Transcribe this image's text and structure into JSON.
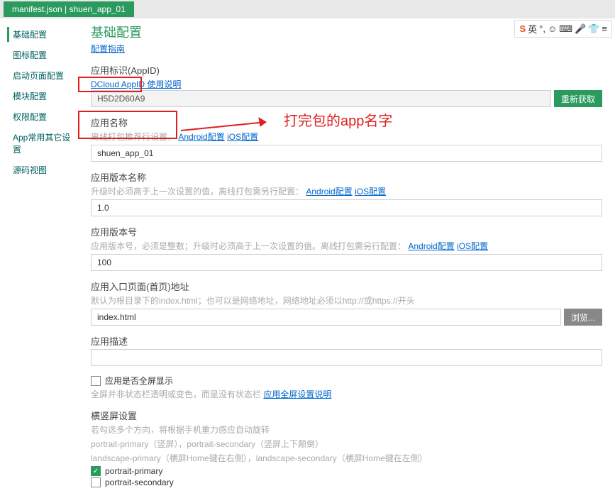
{
  "tab": {
    "title": "manifest.json | shuen_app_01"
  },
  "sidebar": {
    "items": [
      {
        "label": "基础配置"
      },
      {
        "label": "图标配置"
      },
      {
        "label": "启动页面配置"
      },
      {
        "label": "模块配置"
      },
      {
        "label": "权限配置"
      },
      {
        "label": "App常用其它设置"
      },
      {
        "label": "源码视图"
      }
    ]
  },
  "page": {
    "title": "基础配置",
    "guide": "配置指南"
  },
  "appid": {
    "label": "应用标识(AppID)",
    "desc": "DCloud AppID 使用说明",
    "value": "H5D2D60A9",
    "reget": "重新获取"
  },
  "appname": {
    "label": "应用名称",
    "desc_prefix": "离线打包推荐行设置，",
    "desc_link1": "Android配置",
    "desc_link2": "iOS配置",
    "value": "shuen_app_01"
  },
  "annotation": {
    "text": "打完包的app名字"
  },
  "vername": {
    "label": "应用版本名称",
    "desc_prefix": "升级时必须高于上一次设置的值，离线打包需另行配置：",
    "link1": "Android配置",
    "link2": "iOS配置",
    "value": "1.0"
  },
  "vercode": {
    "label": "应用版本号",
    "desc_prefix": "应用版本号，必须是整数；升级时必须高于上一次设置的值。离线打包需另行配置：",
    "link1": "Android配置",
    "link2": "iOS配置",
    "value": "100"
  },
  "entry": {
    "label": "应用入口页面(首页)地址",
    "desc": "默认为根目录下的index.html；也可以是网络地址，网络地址必须以http://或https://开头",
    "value": "index.html",
    "browse": "浏览..."
  },
  "appdesc": {
    "label": "应用描述",
    "value": ""
  },
  "fullscreen": {
    "label": "应用是否全屏显示",
    "desc_prefix": "全屏并非状态栏透明或变色，而是没有状态栏 ",
    "link": "应用全屏设置说明"
  },
  "orient": {
    "label": "横竖屏设置",
    "desc1": "若勾选多个方向，将根据手机重力感应自动旋转",
    "desc2": "portrait-primary（竖屏），portrait-secondary（竖屏上下颠倒）",
    "desc3": "landscape-primary（横屏Home键在右侧），landscape-secondary（横屏Home键在左侧）",
    "opt1": "portrait-primary",
    "opt2": "portrait-secondary"
  },
  "toolbar": {
    "ime": "英"
  }
}
